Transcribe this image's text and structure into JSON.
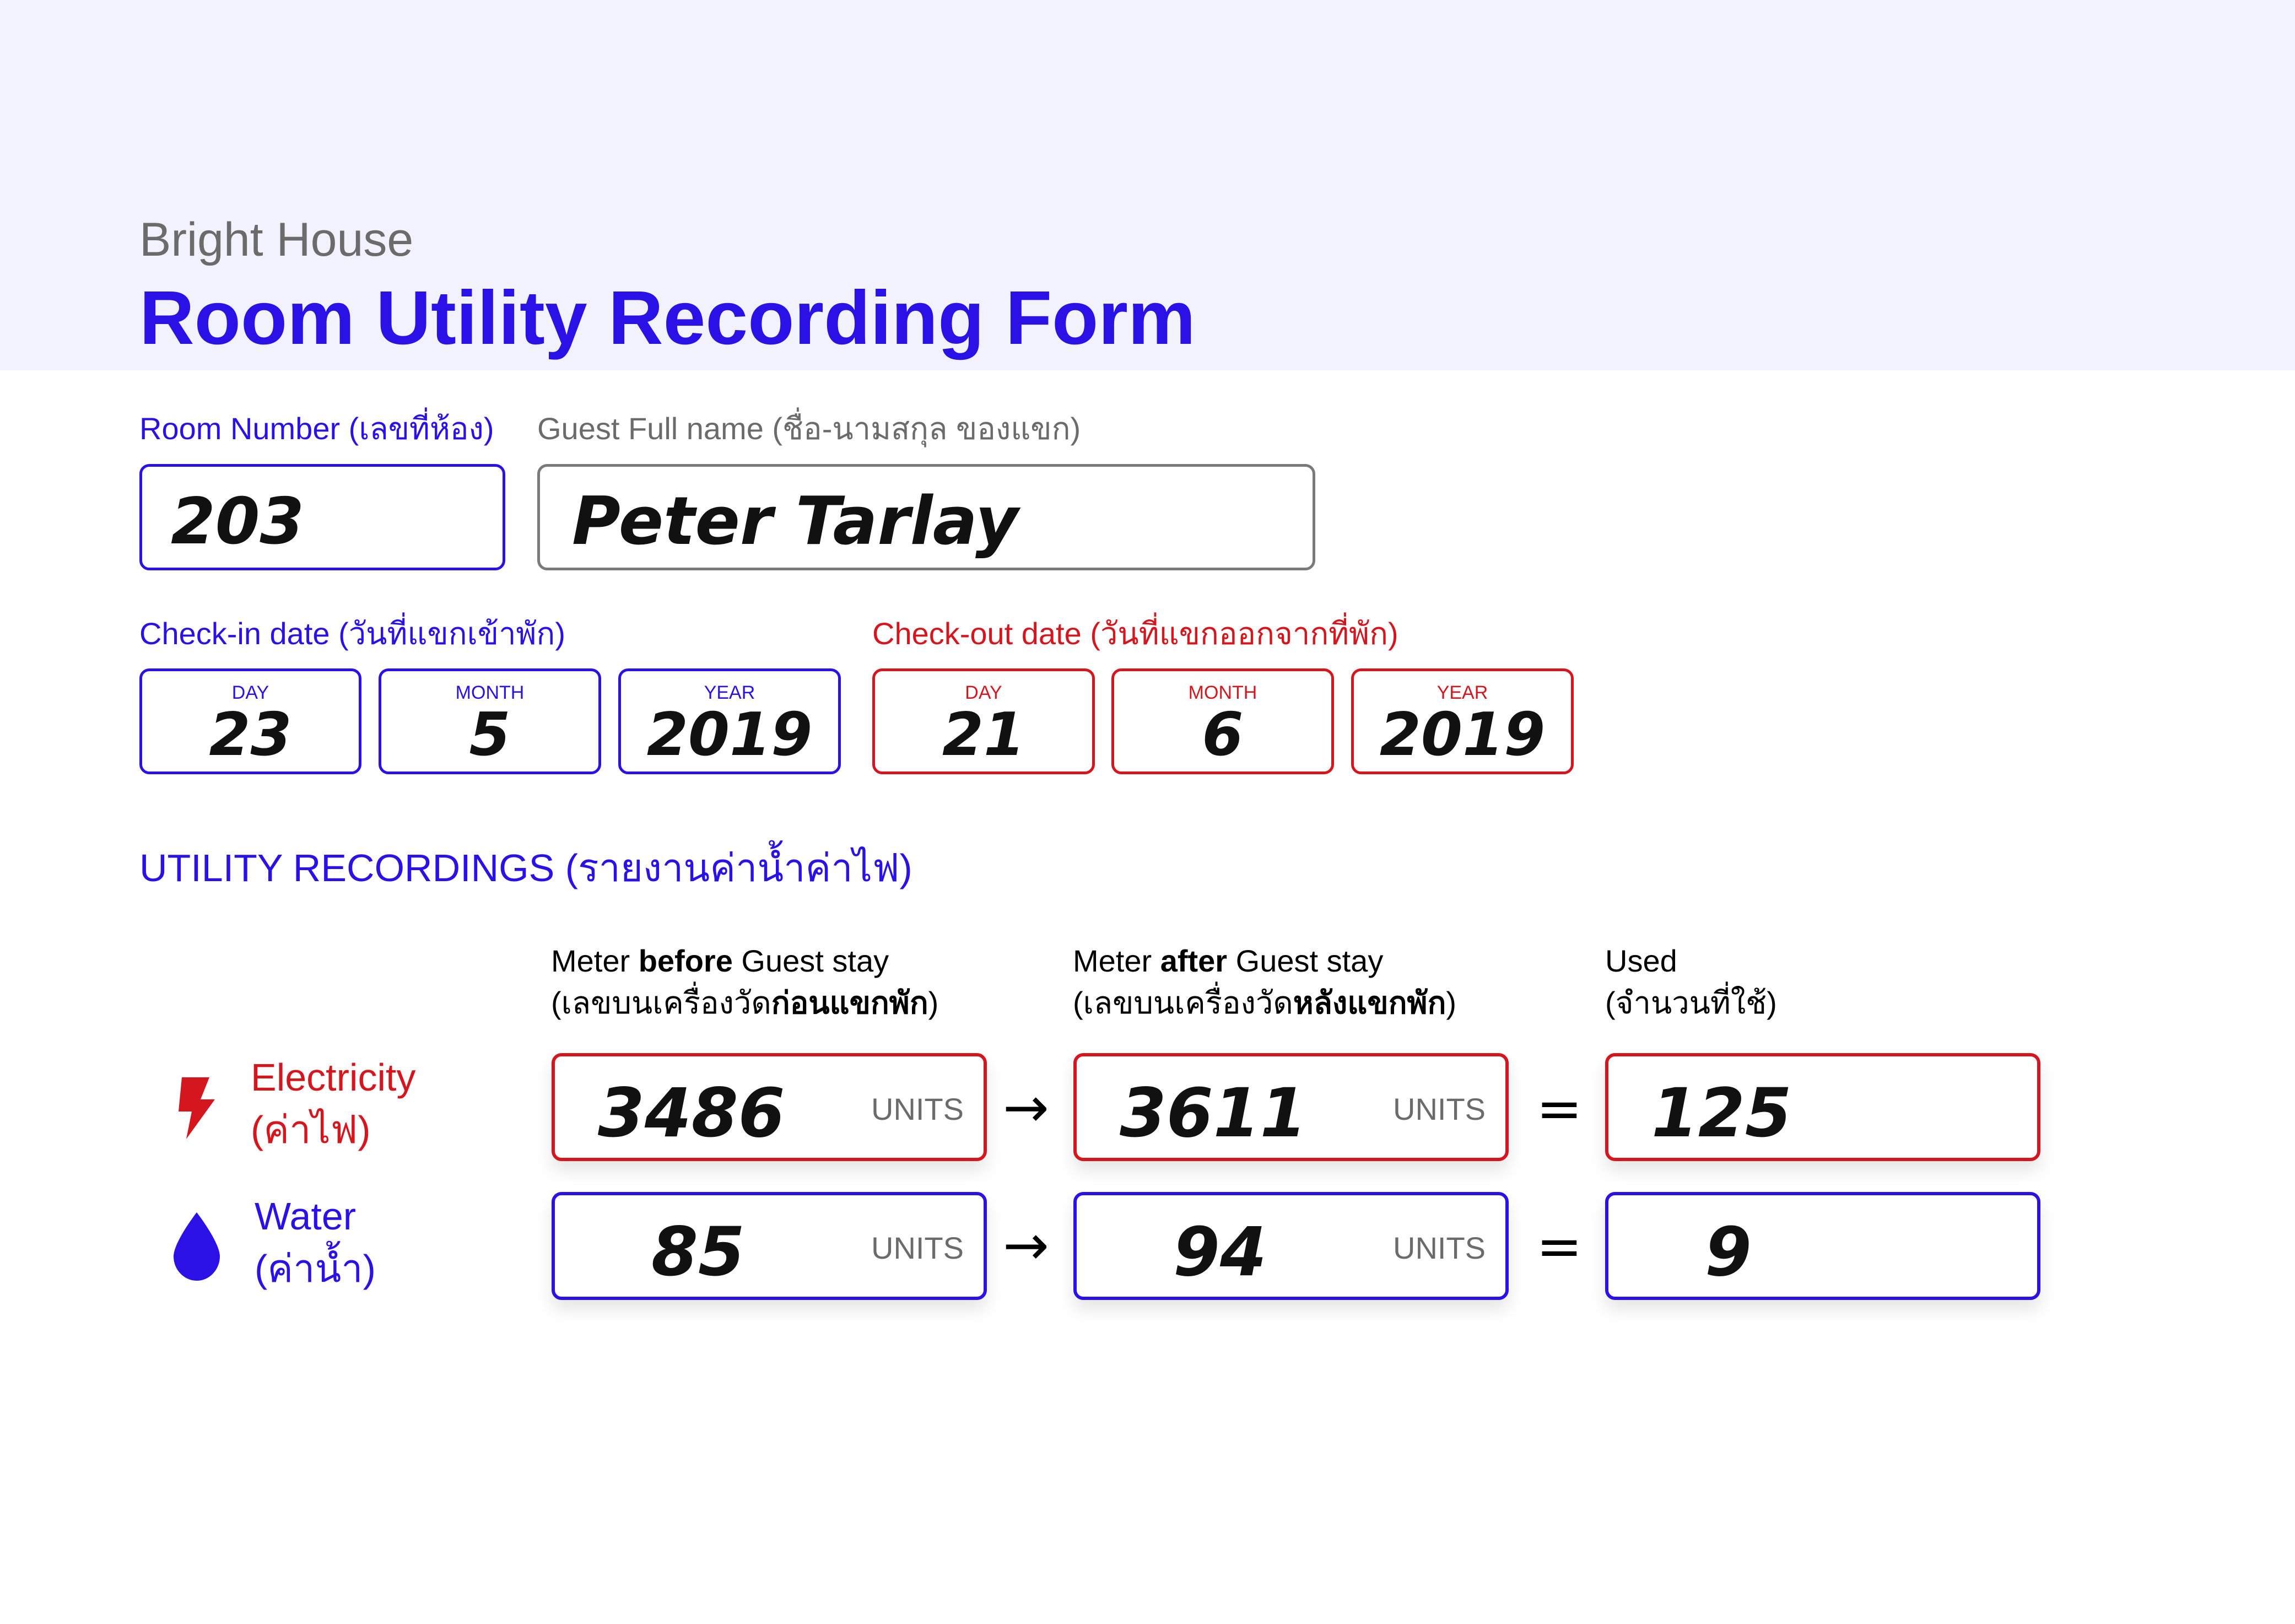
{
  "header": {
    "brand": "Bright House",
    "title": "Room Utility Recording Form"
  },
  "room": {
    "label": "Room Number (เลขที่ห้อง)",
    "value": "203"
  },
  "guest": {
    "label": "Guest Full name  (ชื่อ-นามสกุล ของแขก)",
    "value": "Peter Tarlay"
  },
  "checkin": {
    "label": "Check-in date (วันที่แขกเข้าพัก)",
    "day_label": "DAY",
    "day": "23",
    "month_label": "MONTH",
    "month": "5",
    "year_label": "YEAR",
    "year": "2019"
  },
  "checkout": {
    "label": "Check-out date (วันที่แขกออกจากที่พัก)",
    "day_label": "DAY",
    "day": "21",
    "month_label": "MONTH",
    "month": "6",
    "year_label": "YEAR",
    "year": "2019"
  },
  "utility": {
    "section_title": "UTILITY RECORDINGS (รายงานค่าน้ำค่าไฟ)",
    "col_before": {
      "line1_pre": "Meter ",
      "line1_bold": "before",
      "line1_post": " Guest stay",
      "line2_pre": "(เลขบนเครื่องวัด",
      "line2_bold": "ก่อนแขกพัก",
      "line2_post": ")"
    },
    "col_after": {
      "line1_pre": "Meter ",
      "line1_bold": "after",
      "line1_post": " Guest stay",
      "line2_pre": "(เลขบนเครื่องวัด",
      "line2_bold": "หลังแขกพัก",
      "line2_post": ")"
    },
    "col_used": {
      "line1": "Used",
      "line2": "(จำนวนที่ใช้)"
    },
    "units_label": "UNITS",
    "arrow": "→",
    "equals": "=",
    "electricity": {
      "name": "Electricity",
      "name_th": "(ค่าไฟ)",
      "before": "3486",
      "after": "3611",
      "used": "125"
    },
    "water": {
      "name": "Water",
      "name_th": "(ค่าน้ำ)",
      "before": "85",
      "after": "94",
      "used": "9"
    }
  },
  "colors": {
    "accent_blue": "#2a12e6",
    "accent_red": "#d4171e",
    "header_bg": "#f2f1fe",
    "muted_grey": "#6b6b6b"
  },
  "icons": {
    "electricity": "lightning-bolt-icon",
    "water": "water-drop-icon"
  }
}
